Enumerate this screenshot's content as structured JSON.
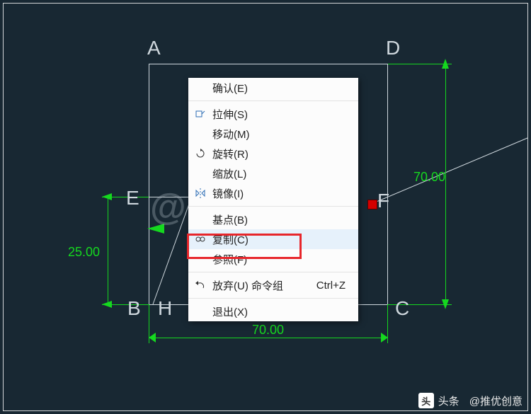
{
  "labels": {
    "A": "A",
    "B": "B",
    "C": "C",
    "D": "D",
    "E": "E",
    "F": "F",
    "H": "H"
  },
  "dimensions": {
    "left_vertical": "25.00",
    "right_vertical": "70.00",
    "bottom_horizontal": "70.00"
  },
  "watermark": "@推优创意",
  "menu": {
    "items": [
      {
        "icon": "",
        "label": "确认(E)",
        "shortcut": ""
      },
      {
        "icon": "stretch",
        "label": "拉伸(S)",
        "shortcut": ""
      },
      {
        "icon": "",
        "label": "移动(M)",
        "shortcut": ""
      },
      {
        "icon": "rotate",
        "label": "旋转(R)",
        "shortcut": ""
      },
      {
        "icon": "",
        "label": "缩放(L)",
        "shortcut": ""
      },
      {
        "icon": "mirror",
        "label": "镜像(I)",
        "shortcut": ""
      },
      {
        "icon": "",
        "label": "基点(B)",
        "shortcut": ""
      },
      {
        "icon": "copy",
        "label": "复制(C)",
        "shortcut": "",
        "hl": true
      },
      {
        "icon": "",
        "label": "参照(F)",
        "shortcut": ""
      },
      {
        "icon": "undo",
        "label": "放弃(U) 命令组",
        "shortcut": "Ctrl+Z"
      },
      {
        "icon": "",
        "label": "退出(X)",
        "shortcut": ""
      }
    ],
    "separators_after": [
      0,
      5,
      8,
      9
    ]
  },
  "footer": {
    "brand": "头条",
    "account": "@推优创意"
  }
}
